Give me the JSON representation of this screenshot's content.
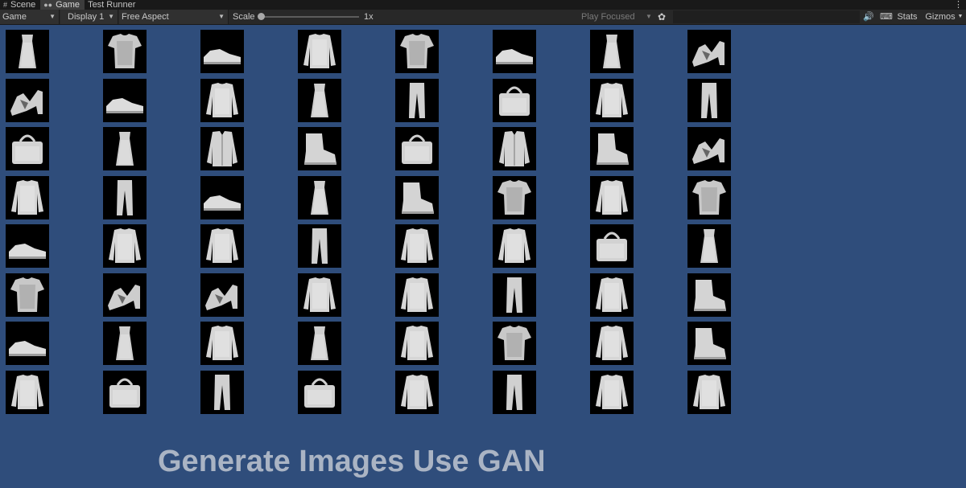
{
  "tabs": [
    {
      "label": "Scene",
      "icon": "grid-icon",
      "active": false
    },
    {
      "label": "Game",
      "icon": "gamepad-icon",
      "active": true
    },
    {
      "label": "Test Runner",
      "icon": "",
      "active": false
    }
  ],
  "toolbar": {
    "game_dropdown": "Game",
    "display_dropdown": "Display 1",
    "aspect_dropdown": "Free Aspect",
    "scale_label": "Scale",
    "scale_value": "1x",
    "play_mode": "Play Focused",
    "stats_label": "Stats",
    "gizmos_label": "Gizmos"
  },
  "caption": "Generate Images Use GAN",
  "grid": {
    "rows": 8,
    "cols": 8,
    "items": [
      "dress",
      "tshirt",
      "sneaker",
      "pullover",
      "tshirt",
      "sneaker",
      "dress",
      "sandal",
      "sandal",
      "sneaker",
      "pullover",
      "dress",
      "trouser",
      "bag",
      "pullover",
      "trouser",
      "bag",
      "dress",
      "coat",
      "ankle-boot",
      "bag",
      "coat",
      "ankle-boot",
      "sandal",
      "pullover",
      "trouser",
      "sneaker",
      "dress",
      "ankle-boot",
      "tshirt",
      "pullover",
      "tshirt",
      "sneaker",
      "pullover",
      "pullover",
      "trouser",
      "pullover",
      "pullover",
      "bag",
      "dress",
      "tshirt",
      "sandal",
      "sandal",
      "pullover",
      "pullover",
      "trouser",
      "pullover",
      "ankle-boot",
      "sneaker",
      "dress",
      "pullover",
      "dress",
      "pullover",
      "tshirt",
      "pullover",
      "ankle-boot",
      "pullover",
      "bag",
      "trouser",
      "bag",
      "pullover",
      "trouser",
      "pullover",
      "pullover"
    ]
  }
}
